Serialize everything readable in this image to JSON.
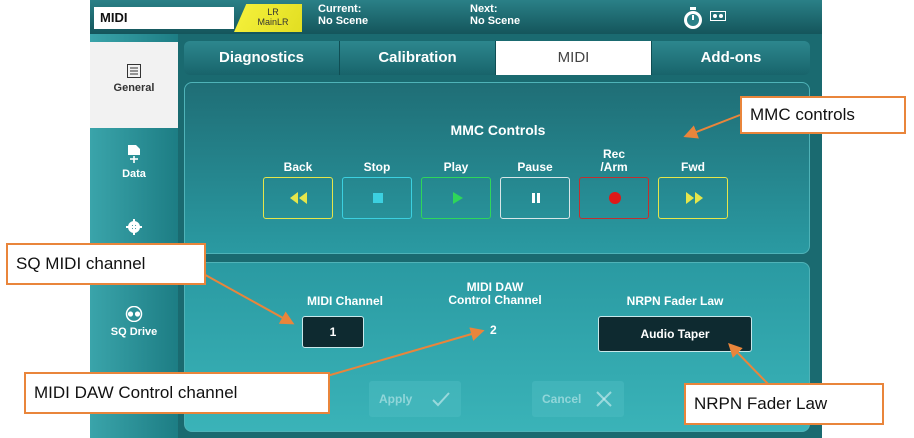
{
  "topbar": {
    "app_title": "MIDI",
    "mix_line1": "LR",
    "mix_line2": "MainLR",
    "current_key": "Current:",
    "current_value": "No Scene",
    "next_key": "Next:",
    "next_value": "No Scene"
  },
  "sidebar": {
    "items": [
      {
        "label": "General",
        "icon": "list-icon"
      },
      {
        "label": "Data",
        "icon": "usb-file-icon"
      },
      {
        "label": "",
        "icon": "gear-icon"
      },
      {
        "label": "SQ Drive",
        "icon": "tape-reel-icon"
      }
    ]
  },
  "tabs": [
    "Diagnostics",
    "Calibration",
    "MIDI",
    "Add-ons"
  ],
  "active_tab": "MIDI",
  "mmc": {
    "title": "MMC Controls",
    "buttons": [
      {
        "label": "Back",
        "icon": "rewind-icon",
        "color": "#e6e64a"
      },
      {
        "label": "Stop",
        "icon": "stop-icon",
        "color": "#3cd0e0"
      },
      {
        "label": "Play",
        "icon": "play-icon",
        "color": "#2ed65a"
      },
      {
        "label": "Pause",
        "icon": "pause-icon",
        "color": "#d8e6e8"
      },
      {
        "label": "Rec\n/Arm",
        "icon": "record-icon",
        "color": "#e01818"
      },
      {
        "label": "Fwd",
        "icon": "fast-forward-icon",
        "color": "#e6e64a"
      }
    ]
  },
  "midi_settings": {
    "midi_channel_label": "MIDI Channel",
    "midi_channel_value": "1",
    "daw_channel_label_line1": "MIDI DAW",
    "daw_channel_label_line2": "Control Channel",
    "daw_channel_value": "2",
    "nrpn_label": "NRPN Fader Law",
    "nrpn_value": "Audio Taper",
    "apply_label": "Apply",
    "cancel_label": "Cancel"
  },
  "callouts": {
    "mmc": "MMC controls",
    "sq_midi": "SQ MIDI channel",
    "daw": "MIDI DAW Control channel",
    "nrpn": "NRPN Fader Law"
  },
  "colors": {
    "accent_callout": "#e9853b",
    "teal_dark": "#14555b",
    "teal_light": "#3ab3b8"
  }
}
